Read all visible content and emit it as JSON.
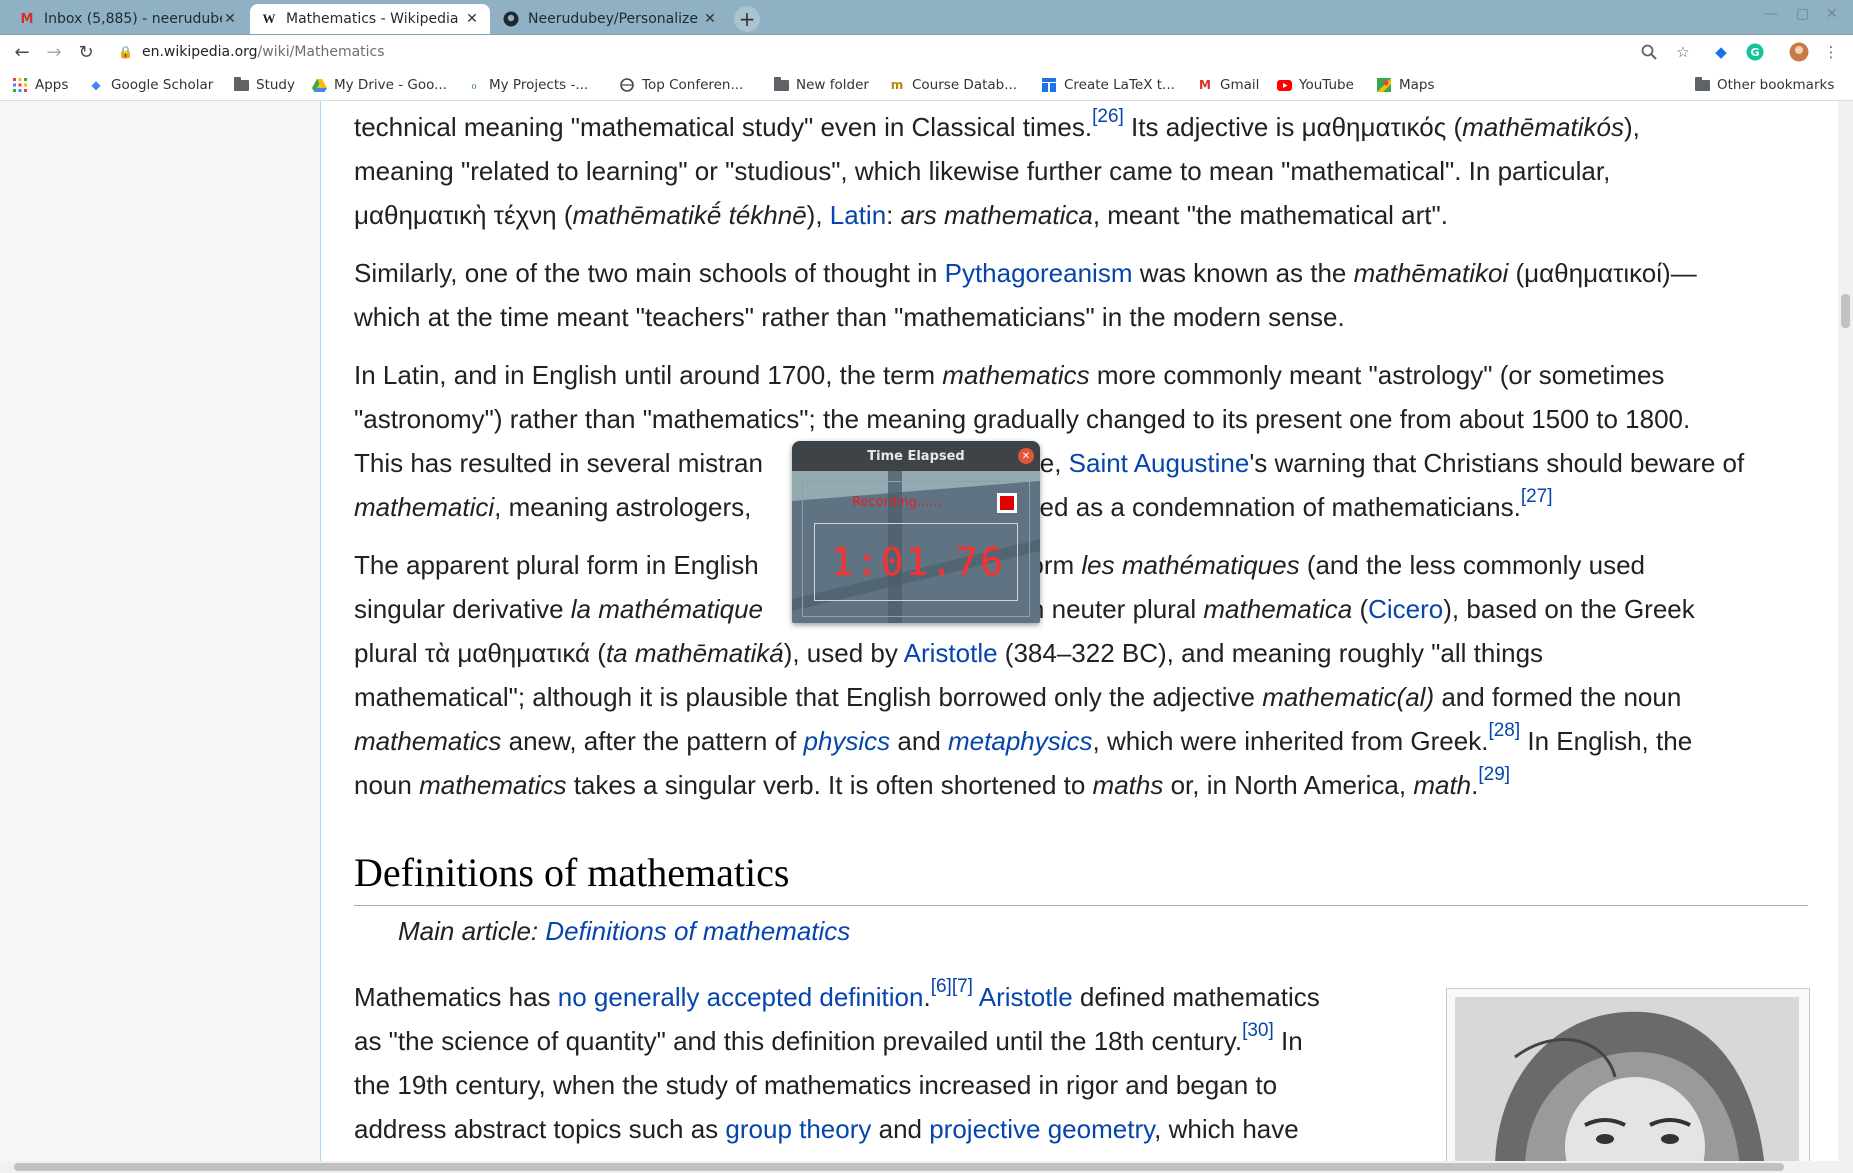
{
  "tabs": [
    {
      "label": "Inbox (5,885) - neerudube",
      "favicon": "gmail-icon",
      "active": false
    },
    {
      "label": "Mathematics - Wikipedia",
      "favicon": "wikipedia-icon",
      "active": true
    },
    {
      "label": "Neerudubey/Personalize",
      "favicon": "github-icon",
      "active": false
    }
  ],
  "toolbar": {
    "url_host": "en.wikipedia.org",
    "url_path": "/wiki/Mathematics"
  },
  "bookmarks": [
    {
      "label": "Apps",
      "icon": "apps-grid-icon"
    },
    {
      "label": "Google Scholar",
      "icon": "scholar-icon"
    },
    {
      "label": "Study",
      "icon": "folder-icon"
    },
    {
      "label": "My Drive - Goo...",
      "icon": "drive-icon"
    },
    {
      "label": "My Projects -...",
      "icon": "leaf-icon"
    },
    {
      "label": "Top Conferen...",
      "icon": "globe-icon"
    },
    {
      "label": "New folder",
      "icon": "folder-icon"
    },
    {
      "label": "Course Datab...",
      "icon": "course-icon"
    },
    {
      "label": "Create LaTeX t...",
      "icon": "table-icon"
    },
    {
      "label": "Gmail",
      "icon": "gmail-icon"
    },
    {
      "label": "YouTube",
      "icon": "youtube-icon"
    },
    {
      "label": "Maps",
      "icon": "maps-icon"
    },
    {
      "label": "Other bookmarks",
      "icon": "folder-icon"
    }
  ],
  "article": {
    "p1": {
      "l1a": "technical meaning \"mathematical study\" even in Classical times.",
      "l1ref": "[26]",
      "l1b": " Its adjective is μαθηματικός (",
      "l1c": "mathēmatikós",
      "l1d": "),",
      "l2": "meaning \"related to learning\" or \"studious\", which likewise further came to mean \"mathematical\". In particular,",
      "l3a": "μαθηματικὴ τέχνη (",
      "l3b": "mathēmatikḗ tékhnē",
      "l3c": "), ",
      "l3link": "Latin",
      "l3d": ": ",
      "l3e": "ars mathematica",
      "l3f": ", meant \"the mathematical art\"."
    },
    "p2": {
      "l1a": "Similarly, one of the two main schools of thought in ",
      "l1link": "Pythagoreanism",
      "l1b": " was known as the ",
      "l1c": "mathēmatikoi",
      "l1d": " (μαθηματικοί)—",
      "l2": "which at the time meant \"teachers\" rather than \"mathematicians\" in the modern sense."
    },
    "p3": {
      "l1a": "In Latin, and in English until around 1700, the term ",
      "l1b": "mathematics",
      "l1c": " more commonly meant \"astrology\" (or sometimes",
      "l2": "\"astronomy\") rather than \"mathematics\"; the meaning gradually changed to its present one from about 1500 to 1800.",
      "l3a": "This has resulted in several mistran",
      "l3b": "le, ",
      "l3link": "Saint Augustine",
      "l3c": "'s warning that Christians should beware of",
      "l4a": "mathematici",
      "l4b": ", meaning astrologers, ",
      "l4c": "nslated as a condemnation of mathematicians.",
      "l4ref": "[27]"
    },
    "p4": {
      "l1a": "The apparent plural form in English",
      "l1b": "al form ",
      "l1c": "les mathématiques",
      "l1d": " (and the less commonly used",
      "l2a": "singular derivative ",
      "l2b": "la mathématique",
      "l2c": "Latin neuter plural ",
      "l2d": "mathematica",
      "l2e": " (",
      "l2link": "Cicero",
      "l2f": "), based on the Greek",
      "l3a": "plural τὰ μαθηματικά (",
      "l3b": "ta mathēmatiká",
      "l3c": "), used by ",
      "l3link": "Aristotle",
      "l3d": " (384–322 BC), and meaning roughly \"all things",
      "l4a": "mathematical\"; although it is plausible that English borrowed only the adjective ",
      "l4b": "mathematic(al)",
      "l4c": " and formed the noun",
      "l5a": "mathematics",
      "l5b": " anew, after the pattern of ",
      "l5link1": "physics",
      "l5c": " and ",
      "l5link2": "metaphysics",
      "l5d": ", which were inherited from Greek.",
      "l5ref": "[28]",
      "l5e": " In English, the",
      "l6a": "noun ",
      "l6b": "mathematics",
      "l6c": " takes a singular verb. It is often shortened to ",
      "l6d": "maths",
      "l6e": " or, in North America, ",
      "l6f": "math",
      "l6g": ".",
      "l6ref": "[29]"
    },
    "heading": "Definitions of mathematics",
    "hatnote_prefix": "Main article: ",
    "hatnote_link": "Definitions of mathematics",
    "p5": {
      "l1a": "Mathematics has ",
      "l1link": "no generally accepted definition",
      "l1b": ".",
      "l1ref1": "[6]",
      "l1ref2": "[7]",
      "l1c": " ",
      "l1link2": "Aristotle",
      "l1d": " defined mathematics",
      "l2a": "as \"the science of quantity\" and this definition prevailed until the 18th century.",
      "l2ref": "[30]",
      "l2b": " In",
      "l3": "the 19th century, when the study of mathematics increased in rigor and began to",
      "l4a": "address abstract topics such as ",
      "l4link1": "group theory",
      "l4b": " and ",
      "l4link2": "projective geometry",
      "l4c": ", which have"
    }
  },
  "timer": {
    "title": "Time Elapsed",
    "status": "Recording......",
    "elapsed": "1:01.76"
  },
  "colors": {
    "link": "#0645ad",
    "tabstrip": "#8fb1c3",
    "timer_digits": "#ff2e2e"
  }
}
